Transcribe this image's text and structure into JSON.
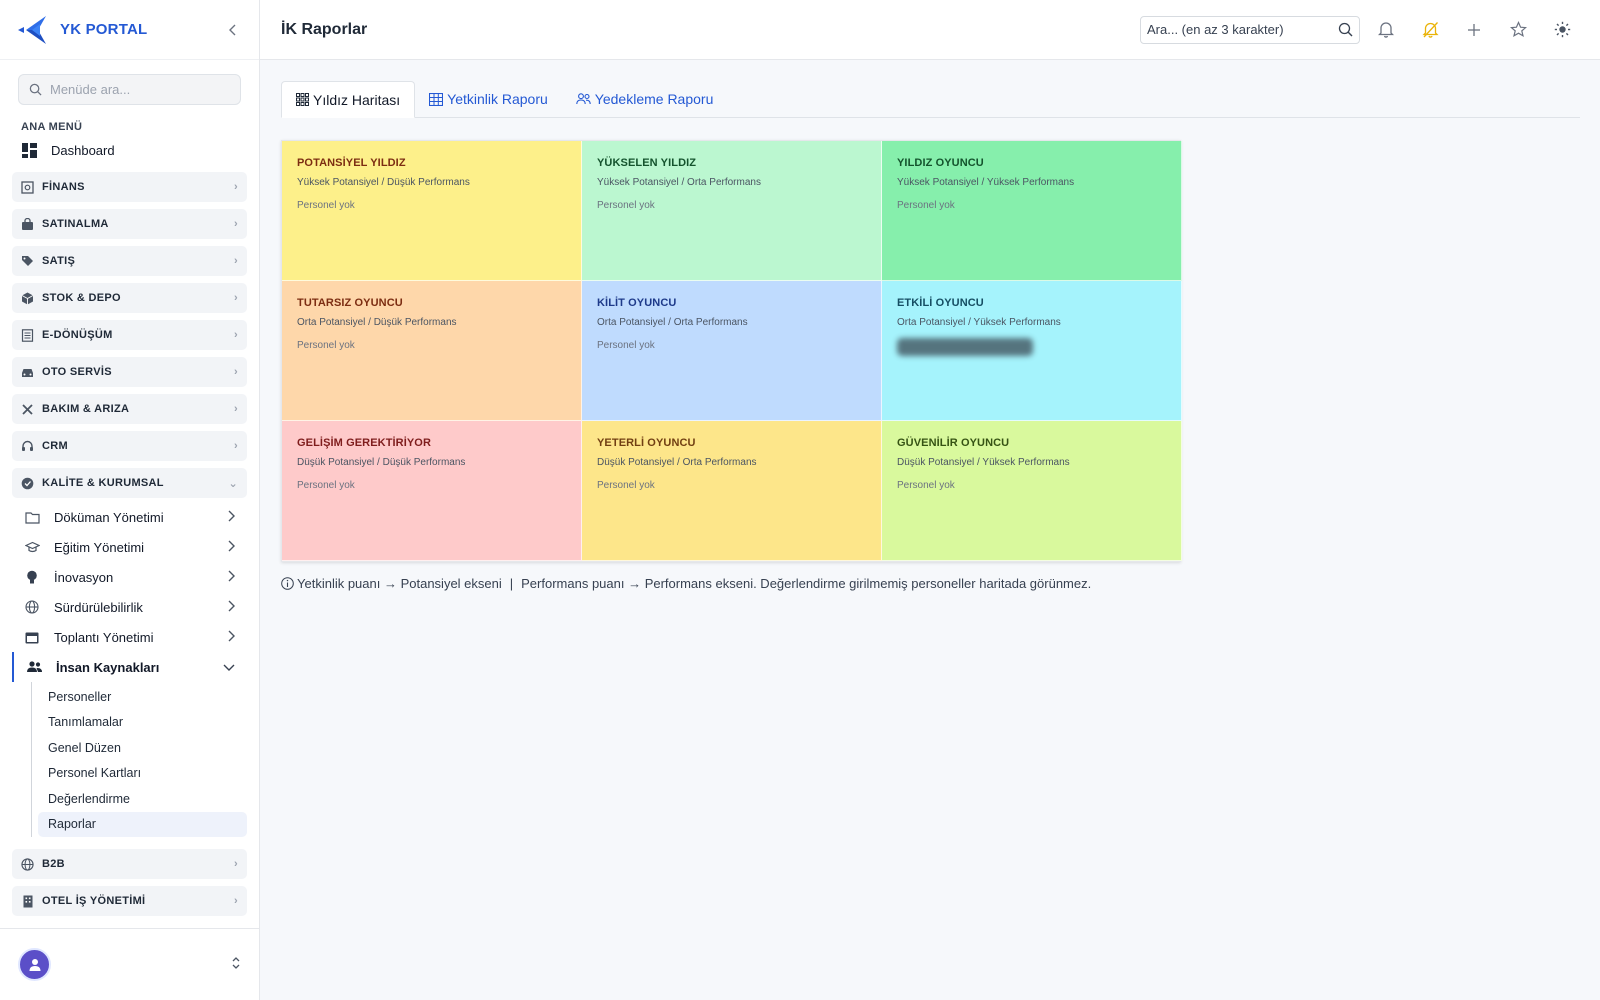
{
  "brand": {
    "name": "YK PORTAL"
  },
  "sidebar": {
    "search_placeholder": "Menüde ara...",
    "section_title": "ANA MENÜ",
    "dashboard_label": "Dashboard",
    "groups_top": [
      {
        "label": "FİNANS",
        "icon": "finance-icon"
      },
      {
        "label": "SATINALMA",
        "icon": "bag-icon"
      },
      {
        "label": "SATIŞ",
        "icon": "tag-icon"
      },
      {
        "label": "STOK & DEPO",
        "icon": "box-icon"
      },
      {
        "label": "E-DÖNÜŞÜM",
        "icon": "document-icon"
      },
      {
        "label": "OTO SERVİS",
        "icon": "car-icon"
      },
      {
        "label": "BAKIM & ARIZA",
        "icon": "tools-icon"
      },
      {
        "label": "CRM",
        "icon": "headset-icon"
      },
      {
        "label": "KALİTE & KURUMSAL",
        "icon": "badge-icon"
      }
    ],
    "sub_items": [
      {
        "label": "Döküman Yönetimi",
        "icon": "folder-icon"
      },
      {
        "label": "Eğitim Yönetimi",
        "icon": "graduation-icon"
      },
      {
        "label": "İnovasyon",
        "icon": "bulb-icon"
      },
      {
        "label": "Sürdürülebilirlik",
        "icon": "globe-icon"
      },
      {
        "label": "Toplantı Yönetimi",
        "icon": "calendar-icon"
      },
      {
        "label": "İnsan Kaynakları",
        "icon": "users-icon"
      }
    ],
    "leaves": [
      "Personeller",
      "Tanımlamalar",
      "Genel Düzen",
      "Personel Kartları",
      "Değerlendirme",
      "Raporlar"
    ],
    "groups_bottom": [
      {
        "label": "B2B",
        "icon": "globe-icon"
      },
      {
        "label": "OTEL İŞ YÖNETİMİ",
        "icon": "building-icon"
      }
    ]
  },
  "header": {
    "title": "İK Raporlar",
    "search_placeholder": "Ara... (en az 3 karakter)"
  },
  "tabs": [
    {
      "label": "Yıldız Haritası",
      "icon": "grid-icon"
    },
    {
      "label": "Yetkinlik Raporu",
      "icon": "table-icon"
    },
    {
      "label": "Yedekleme Raporu",
      "icon": "users-icon"
    }
  ],
  "matrix": [
    {
      "title": "POTANSİYEL YILDIZ",
      "subtitle": "Yüksek Potansiyel / Düşük Performans",
      "status": "Personel yok",
      "bg": "#fdf08a",
      "fg": "#7c2d12"
    },
    {
      "title": "YÜKSELEN YILDIZ",
      "subtitle": "Yüksek Potansiyel / Orta Performans",
      "status": "Personel yok",
      "bg": "#bbf7d0",
      "fg": "#14532d"
    },
    {
      "title": "YILDIZ OYUNCU",
      "subtitle": "Yüksek Potansiyel / Yüksek Performans",
      "status": "Personel yok",
      "bg": "#86efac",
      "fg": "#14532d"
    },
    {
      "title": "TUTARSIZ OYUNCU",
      "subtitle": "Orta Potansiyel / Düşük Performans",
      "status": "Personel yok",
      "bg": "#fed7aa",
      "fg": "#7c2d12"
    },
    {
      "title": "KİLİT OYUNCU",
      "subtitle": "Orta Potansiyel / Orta Performans",
      "status": "Personel yok",
      "bg": "#bfdbfe",
      "fg": "#1e3a8a"
    },
    {
      "title": "ETKİLİ OYUNCU",
      "subtitle": "Orta Potansiyel / Yüksek Performans",
      "status": "",
      "bg": "#a5f3fc",
      "fg": "#164e63"
    },
    {
      "title": "GELİŞİM GEREKTİRİYOR",
      "subtitle": "Düşük Potansiyel / Düşük Performans",
      "status": "Personel yok",
      "bg": "#fecaca",
      "fg": "#7f1d1d"
    },
    {
      "title": "YETERLİ OYUNCU",
      "subtitle": "Düşük Potansiyel / Orta Performans",
      "status": "Personel yok",
      "bg": "#fde68a",
      "fg": "#713f12"
    },
    {
      "title": "GÜVENİLİR OYUNCU",
      "subtitle": "Düşük Potansiyel / Yüksek Performans",
      "status": "Personel yok",
      "bg": "#d9f99d",
      "fg": "#365314"
    }
  ],
  "note": {
    "part1": "Yetkinlik puanı → Potansiyel ekseni",
    "separator": "|",
    "part2": "Performans puanı → Performans ekseni. Değerlendirme girilmemiş personeller haritada görünmez."
  },
  "colors": {
    "accent": "#2459d4",
    "bell_alert": "#eab308"
  }
}
